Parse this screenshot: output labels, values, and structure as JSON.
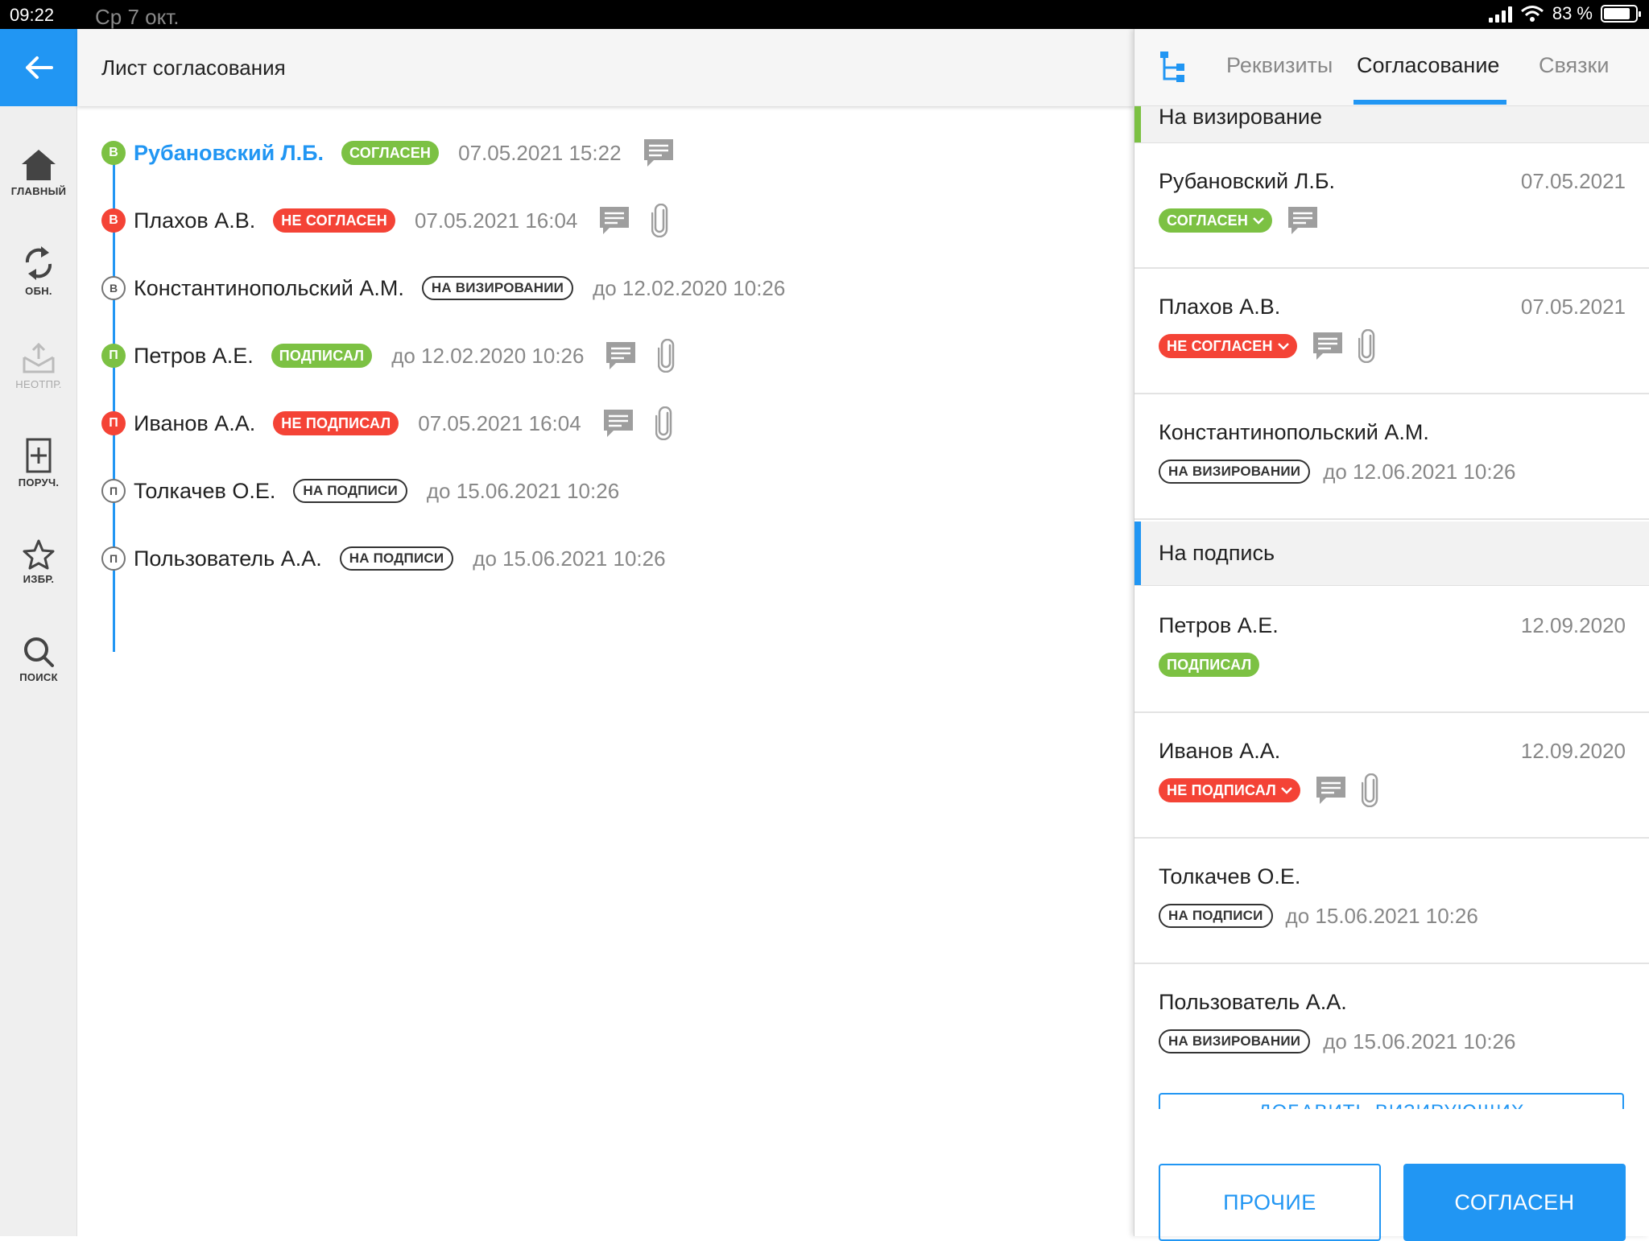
{
  "status_bar": {
    "time": "09:22",
    "date": "Ср 7 окт.",
    "battery": "83 %"
  },
  "header": {
    "title": "Лист согласования"
  },
  "rail": [
    {
      "label": "ГЛАВНЫЙ",
      "icon": "home-icon"
    },
    {
      "label": "ОБН.",
      "icon": "refresh-icon"
    },
    {
      "label": "НЕОТПР.",
      "icon": "outbox-icon"
    },
    {
      "label": "ПОРУЧ.",
      "icon": "add-task-icon"
    },
    {
      "label": "ИЗБР.",
      "icon": "star-icon"
    },
    {
      "label": "ПОИСК",
      "icon": "search-icon"
    }
  ],
  "flow": [
    {
      "letter": "В",
      "name": "Рубановский Л.Б.",
      "status": "СОГЛАСЕН",
      "date": "07.05.2021 15:22",
      "comment": true,
      "attach": false
    },
    {
      "letter": "В",
      "name": "Плахов А.В.",
      "status": "НЕ СОГЛАСЕН",
      "date": "07.05.2021 16:04",
      "comment": true,
      "attach": true
    },
    {
      "letter": "В",
      "name": "Константинопольский А.М.",
      "status": "НА ВИЗИРОВАНИИ",
      "date": "до 12.02.2020 10:26",
      "comment": false,
      "attach": false
    },
    {
      "letter": "П",
      "name": "Петров А.Е.",
      "status": "ПОДПИСАЛ",
      "date": "до 12.02.2020 10:26",
      "comment": true,
      "attach": true
    },
    {
      "letter": "П",
      "name": "Иванов А.А.",
      "status": "НЕ ПОДПИСАЛ",
      "date": "07.05.2021 16:04",
      "comment": true,
      "attach": true
    },
    {
      "letter": "П",
      "name": "Толкачев О.Е.",
      "status": "НА ПОДПИСИ",
      "date": "до 15.06.2021 10:26",
      "comment": false,
      "attach": false
    },
    {
      "letter": "П",
      "name": "Пользователь А.А.",
      "status": "НА ПОДПИСИ",
      "date": "до 15.06.2021 10:26",
      "comment": false,
      "attach": false
    }
  ],
  "right_panel": {
    "tabs": [
      "Реквизиты",
      "Согласование",
      "Связки"
    ],
    "section_visa": "На визирование",
    "section_sign": "На подпись",
    "cards": [
      {
        "name": "Рубановский Л.Б.",
        "date": "07.05.2021",
        "status": "СОГЛАСЕН"
      },
      {
        "name": "Плахов А.В.",
        "date": "07.05.2021",
        "status": "НЕ СОГЛАСЕН"
      },
      {
        "name": "Константинопольский А.М.",
        "status": "НА ВИЗИРОВАНИИ",
        "deadline": "до 12.06.2021 10:26"
      },
      {
        "name": "Петров А.Е.",
        "date": "12.09.2020",
        "status": "ПОДПИСАЛ"
      },
      {
        "name": "Иванов А.А.",
        "date": "12.09.2020",
        "status": "НЕ ПОДПИСАЛ"
      },
      {
        "name": "Толкачев О.Е.",
        "status": "НА ПОДПИСИ",
        "deadline": "до 15.06.2021 10:26"
      },
      {
        "name": "Пользователь А.А.",
        "status": "НА ВИЗИРОВАНИИ",
        "deadline": "до 15.06.2021 10:26"
      }
    ],
    "add_button": "ДОБАВИТЬ ВИЗИРУЮЩИХ",
    "btn_other": "ПРОЧИЕ",
    "btn_agree": "СОГЛАСЕН"
  },
  "colors": {
    "accent": "#2196f3",
    "green": "#7cc143",
    "red": "#f44336"
  }
}
